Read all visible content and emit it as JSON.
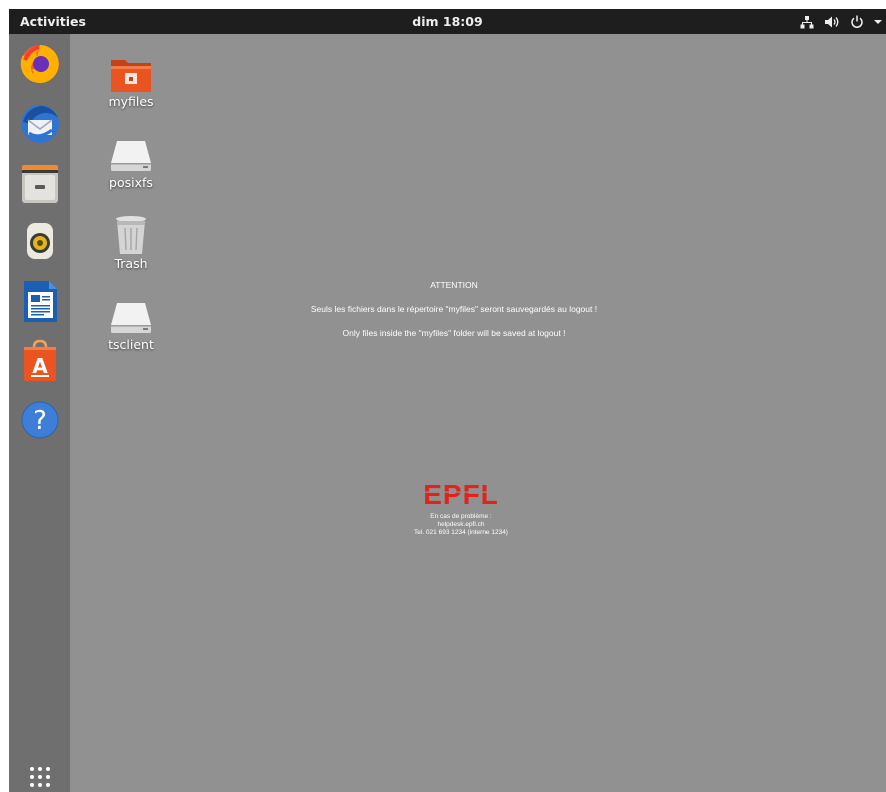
{
  "topbar": {
    "activities_label": "Activities",
    "clock": "dim 18:09"
  },
  "dock": {
    "items": [
      {
        "name": "Firefox Web Browser",
        "icon": "firefox-icon"
      },
      {
        "name": "Thunderbird Mail",
        "icon": "thunderbird-icon"
      },
      {
        "name": "Files",
        "icon": "file-cabinet-icon"
      },
      {
        "name": "Rhythmbox",
        "icon": "speaker-icon"
      },
      {
        "name": "LibreOffice Writer",
        "icon": "writer-document-icon"
      },
      {
        "name": "Ubuntu Software",
        "icon": "software-bag-icon"
      },
      {
        "name": "Help",
        "icon": "help-icon"
      }
    ],
    "show_apps_icon": "app-grid-icon"
  },
  "desktop": {
    "icons": [
      {
        "label": "myfiles",
        "icon": "home-folder-icon"
      },
      {
        "label": "posixfs",
        "icon": "drive-icon"
      },
      {
        "label": "Trash",
        "icon": "trash-icon"
      },
      {
        "label": "tsclient",
        "icon": "drive-icon"
      }
    ]
  },
  "notice": {
    "heading": "ATTENTION",
    "line_fr": "Seuls les fichiers dans le répertoire \"myfiles\" seront sauvegardés au logout !",
    "line_en": "Only files inside the \"myfiles\" folder will be saved at logout !"
  },
  "epfl": {
    "logo_text": "EPFL",
    "contact_line1": "En cas de problème :",
    "contact_line2": "helpdesk.epfl.ch",
    "contact_line3": "Tel. 021 693 1234 (interne 1234)"
  },
  "colors": {
    "desktop_bg": "#919191",
    "topbar_bg": "#1e1e1e",
    "dock_bg": "#6f6f6f",
    "epfl_red": "#e2231a",
    "folder_orange": "#e95420"
  }
}
